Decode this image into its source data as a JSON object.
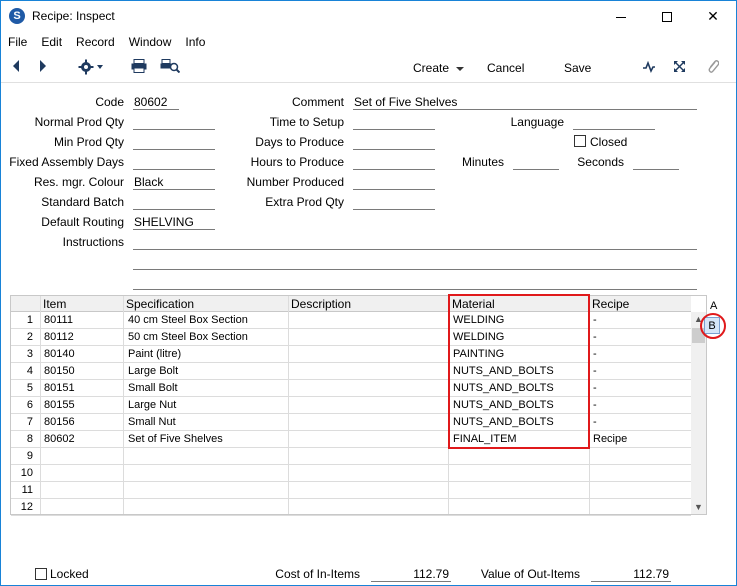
{
  "window": {
    "title": "Recipe: Inspect",
    "icon": "S"
  },
  "menu": [
    "File",
    "Edit",
    "Record",
    "Window",
    "Info"
  ],
  "toolbar": {
    "create_label": "Create",
    "cancel_label": "Cancel",
    "save_label": "Save"
  },
  "form": {
    "code_label": "Code",
    "code_value": "80602",
    "normal_prod_qty_label": "Normal Prod Qty",
    "normal_prod_qty_value": "",
    "min_prod_qty_label": "Min Prod Qty",
    "min_prod_qty_value": "",
    "fixed_assembly_days_label": "Fixed Assembly Days",
    "fixed_assembly_days_value": "",
    "res_mgr_colour_label": "Res. mgr. Colour",
    "res_mgr_colour_value": "Black",
    "standard_batch_label": "Standard Batch",
    "standard_batch_value": "",
    "default_routing_label": "Default Routing",
    "default_routing_value": "SHELVING",
    "instructions_label": "Instructions",
    "comment_label": "Comment",
    "comment_value": "Set of Five Shelves",
    "time_to_setup_label": "Time to Setup",
    "time_to_setup_value": "",
    "days_to_produce_label": "Days to Produce",
    "days_to_produce_value": "",
    "hours_to_produce_label": "Hours to Produce",
    "hours_to_produce_value": "",
    "number_produced_label": "Number Produced",
    "number_produced_value": "",
    "extra_prod_qty_label": "Extra Prod Qty",
    "extra_prod_qty_value": "",
    "language_label": "Language",
    "language_value": "",
    "closed_label": "Closed",
    "minutes_label": "Minutes",
    "minutes_value": "",
    "seconds_label": "Seconds",
    "seconds_value": ""
  },
  "grid": {
    "headers": {
      "item": "Item",
      "specification": "Specification",
      "description": "Description",
      "material": "Material",
      "recipe": "Recipe"
    },
    "tab_a": "A",
    "tab_b": "B",
    "rows": [
      {
        "n": "1",
        "item": "80111",
        "spec": "40 cm Steel Box Section",
        "desc": "",
        "material": "WELDING",
        "recipe": "-"
      },
      {
        "n": "2",
        "item": "80112",
        "spec": "50 cm Steel Box Section",
        "desc": "",
        "material": "WELDING",
        "recipe": "-"
      },
      {
        "n": "3",
        "item": "80140",
        "spec": "Paint (litre)",
        "desc": "",
        "material": "PAINTING",
        "recipe": "-"
      },
      {
        "n": "4",
        "item": "80150",
        "spec": "Large Bolt",
        "desc": "",
        "material": "NUTS_AND_BOLTS",
        "recipe": "-"
      },
      {
        "n": "5",
        "item": "80151",
        "spec": "Small Bolt",
        "desc": "",
        "material": "NUTS_AND_BOLTS",
        "recipe": "-"
      },
      {
        "n": "6",
        "item": "80155",
        "spec": "Large Nut",
        "desc": "",
        "material": "NUTS_AND_BOLTS",
        "recipe": "-"
      },
      {
        "n": "7",
        "item": "80156",
        "spec": "Small Nut",
        "desc": "",
        "material": "NUTS_AND_BOLTS",
        "recipe": "-"
      },
      {
        "n": "8",
        "item": "80602",
        "spec": "Set of Five Shelves",
        "desc": "",
        "material": "FINAL_ITEM",
        "recipe": "Recipe"
      },
      {
        "n": "9",
        "item": "",
        "spec": "",
        "desc": "",
        "material": "",
        "recipe": ""
      },
      {
        "n": "10",
        "item": "",
        "spec": "",
        "desc": "",
        "material": "",
        "recipe": ""
      },
      {
        "n": "11",
        "item": "",
        "spec": "",
        "desc": "",
        "material": "",
        "recipe": ""
      },
      {
        "n": "12",
        "item": "",
        "spec": "",
        "desc": "",
        "material": "",
        "recipe": ""
      }
    ]
  },
  "footer": {
    "locked_label": "Locked",
    "cost_in_items_label": "Cost of In-Items",
    "cost_in_items_value": "112.79",
    "value_out_items_label": "Value of Out-Items",
    "value_out_items_value": "112.79"
  },
  "colors": {
    "highlight": "#e0191b",
    "window_border": "#1883d7"
  }
}
